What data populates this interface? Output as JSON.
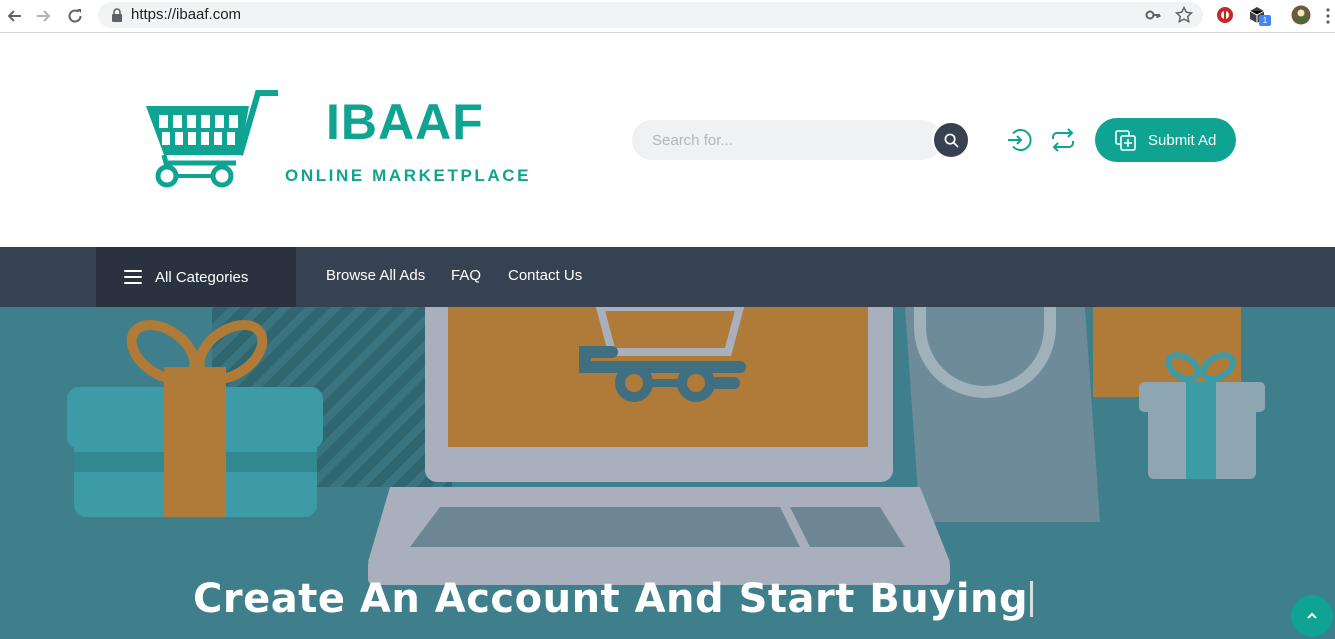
{
  "browser": {
    "url": "https://ibaaf.com",
    "extension_badge": "1"
  },
  "header": {
    "logo_title": "IBAAF",
    "logo_subtitle": "ONLINE MARKETPLACE",
    "search_placeholder": "Search for...",
    "submit_label": "Submit Ad"
  },
  "nav": {
    "all_categories": "All Categories",
    "links": [
      "Browse All Ads",
      "FAQ",
      "Contact Us"
    ]
  },
  "hero": {
    "title": "Create An Account And Start Buying"
  },
  "colors": {
    "brand": "#0fa392",
    "navbar": "#364152",
    "navbar_dark": "#2a3240",
    "hero_bg": "#3f7e8b"
  },
  "icons": [
    "back-arrow-icon",
    "forward-arrow-icon",
    "reload-icon",
    "lock-icon",
    "key-icon",
    "star-icon",
    "search-icon",
    "login-icon",
    "sync-icon",
    "add-post-icon",
    "hamburger-icon",
    "chevron-up-icon"
  ]
}
